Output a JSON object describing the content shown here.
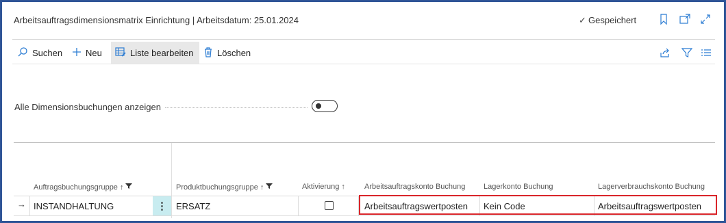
{
  "window": {
    "title": "Arbeitsauftragsdimensionsmatrix Einrichtung | Arbeitsdatum: 25.01.2024",
    "saved_label": "Gespeichert"
  },
  "icons": {
    "bookmark": "bookmark-icon",
    "open_new": "open-in-new-window-icon",
    "expand": "expand-icon",
    "search": "search-icon",
    "plus": "plus-icon",
    "edit_list": "edit-list-icon",
    "delete": "trash-icon",
    "share": "share-icon",
    "filter": "filter-icon",
    "list_view": "list-view-icon"
  },
  "actions": {
    "search": "Suchen",
    "new": "Neu",
    "edit_list": "Liste bearbeiten",
    "delete": "Löschen"
  },
  "options": {
    "show_all_label": "Alle Dimensionsbuchungen anzeigen",
    "show_all_value": false
  },
  "table": {
    "columns": [
      "Auftragsbuchungsgruppe",
      "Produktbuchungsgruppe",
      "Aktivierung",
      "Arbeitsauftragskonto Buchung",
      "Lagerkonto Buchung",
      "Lagerverbrauchskonto Buchung"
    ],
    "sort_arrow": "↑",
    "rows": [
      {
        "auftragsbuchungsgruppe": "INSTANDHALTUNG",
        "produktbuchungsgruppe": "ERSATZ",
        "aktivierung": false,
        "arbeitsauftragskonto": "Arbeitsauftragswertposten",
        "lagerkonto": "Kein Code",
        "lagerverbrauchskonto": "Arbeitsauftragswertposten"
      }
    ]
  },
  "colors": {
    "frame": "#2f5597",
    "highlight": "#d9252a",
    "menu_cell": "#c8ecf0",
    "accent": "#2b7cd3"
  }
}
